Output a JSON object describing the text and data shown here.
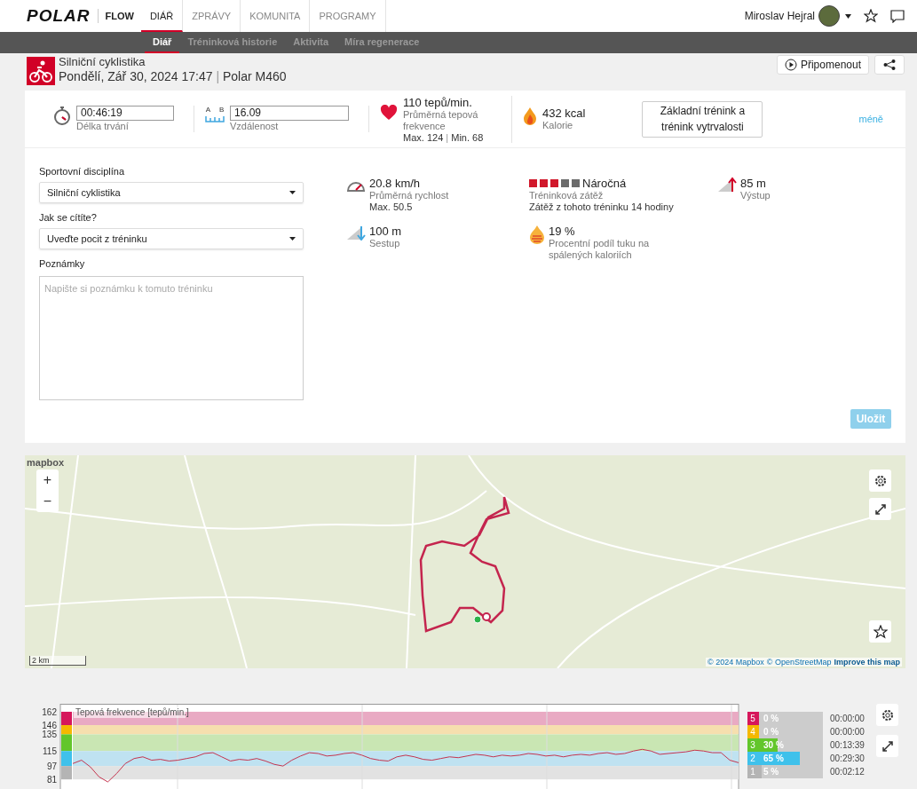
{
  "header": {
    "logo": "POLAR",
    "product": "FLOW",
    "user": "Miroslav Hejral",
    "nav": [
      {
        "label": "DIÁŘ",
        "selected": true
      },
      {
        "label": "ZPRÁVY",
        "selected": false
      },
      {
        "label": "KOMUNITA",
        "selected": false
      },
      {
        "label": "PROGRAMY",
        "selected": false
      }
    ]
  },
  "subnav": [
    {
      "label": "Diář",
      "selected": true
    },
    {
      "label": "Tréninková historie",
      "selected": false
    },
    {
      "label": "Aktivita",
      "selected": false
    },
    {
      "label": "Míra regenerace",
      "selected": false
    }
  ],
  "session": {
    "sport": "Silniční cyklistika",
    "date": "Pondělí, Zář 30, 2024 17:47",
    "separator": "|",
    "device": "Polar M460",
    "remind_button": "Připomenout"
  },
  "summary": {
    "duration": {
      "value": "00:46:19",
      "label": "Délka trvání"
    },
    "distance": {
      "value": "16.09",
      "label": "Vzdálenost",
      "point_a": "A",
      "point_b": "B"
    },
    "heart_rate": {
      "value": "110 tepů/min.",
      "label": "Průměrná tepová frekvence",
      "max": "Max. 124",
      "separator": "|",
      "min": "Min. 68"
    },
    "calories": {
      "value": "432 kcal",
      "label": "Kalorie"
    },
    "benefit_button": "Základní trénink a trénink vytrvalosti",
    "less_link": "méně"
  },
  "form": {
    "sport_label": "Sportovní disciplína",
    "sport_value": "Silniční cyklistika",
    "feeling_label": "Jak se cítíte?",
    "feeling_value": "Uveďte pocit z tréninku",
    "notes_label": "Poznámky",
    "notes_placeholder": "Napište si poznámku k tomuto tréninku",
    "save_button": "Uložit"
  },
  "stats": [
    {
      "kind": "speed",
      "value": "20.8 km/h",
      "label": "Průměrná rychlost",
      "detail": "Max. 50.5"
    },
    {
      "kind": "load",
      "value": "Náročná",
      "label": "Tréninková zátěž",
      "detail": "Zátěž z tohoto tréninku 14 hodiny",
      "stars": 3
    },
    {
      "kind": "ascent",
      "value": "85 m",
      "label": "Výstup"
    },
    {
      "kind": "descent",
      "value": "100 m",
      "label": "Sestup"
    },
    {
      "kind": "fat",
      "value": "19 %",
      "label": "Procentní podíl tuku na spálených kaloriích"
    }
  ],
  "map": {
    "logo": "mapbox",
    "zoom_in": "+",
    "zoom_out": "−",
    "scale": "2 km",
    "attribution": [
      "© 2024 Mapbox",
      "© OpenStreetMap",
      "Improve this map"
    ]
  },
  "chart": {
    "chart_data": {
      "type": "line",
      "title": "Tepová frekvence [tepů/min.]",
      "ylim": [
        61,
        171
      ],
      "yticks": [
        81,
        97,
        115,
        135,
        146,
        162
      ],
      "grid": true,
      "bands": [
        {
          "axis": "y",
          "from": 146,
          "to": 162,
          "color": "#e9aac3"
        },
        {
          "axis": "y",
          "from": 135,
          "to": 146,
          "color": "#f6dfae"
        },
        {
          "axis": "y",
          "from": 115,
          "to": 135,
          "color": "#c9e6b3"
        },
        {
          "axis": "y",
          "from": 97,
          "to": 115,
          "color": "#bfe2f1"
        },
        {
          "axis": "y",
          "from": 81,
          "to": 97,
          "color": "#e2e2e2"
        }
      ],
      "series": [
        {
          "color": "#c5344e",
          "values": [
            100,
            104,
            96,
            84,
            78,
            88,
            100,
            106,
            108,
            104,
            105,
            103,
            104,
            106,
            108,
            112,
            113,
            108,
            103,
            105,
            104,
            106,
            103,
            99,
            97,
            104,
            109,
            113,
            112,
            109,
            110,
            112,
            113,
            110,
            106,
            104,
            103,
            108,
            110,
            108,
            105,
            104,
            106,
            108,
            107,
            109,
            111,
            110,
            108,
            110,
            109,
            110,
            112,
            111,
            109,
            110,
            108,
            110,
            111,
            110,
            112,
            113,
            111,
            112,
            115,
            117,
            115,
            111,
            112,
            113,
            114,
            116,
            115,
            113,
            113,
            104,
            101
          ]
        }
      ]
    },
    "zones": [
      {
        "zone": "5",
        "share": "0 %",
        "level": 0,
        "time": "00:00:00",
        "color": "#d6175b"
      },
      {
        "zone": "4",
        "share": "0 %",
        "level": 0,
        "time": "00:00:00",
        "color": "#f5b800"
      },
      {
        "zone": "3",
        "share": "30 %",
        "level": 0.3,
        "time": "00:13:39",
        "color": "#62c62b"
      },
      {
        "zone": "2",
        "share": "65 %",
        "level": 0.65,
        "time": "00:29:30",
        "color": "#3fc1eb"
      },
      {
        "zone": "1",
        "share": "5 %",
        "level": 0.05,
        "time": "00:02:12",
        "color": "#b4b4b4"
      }
    ]
  }
}
